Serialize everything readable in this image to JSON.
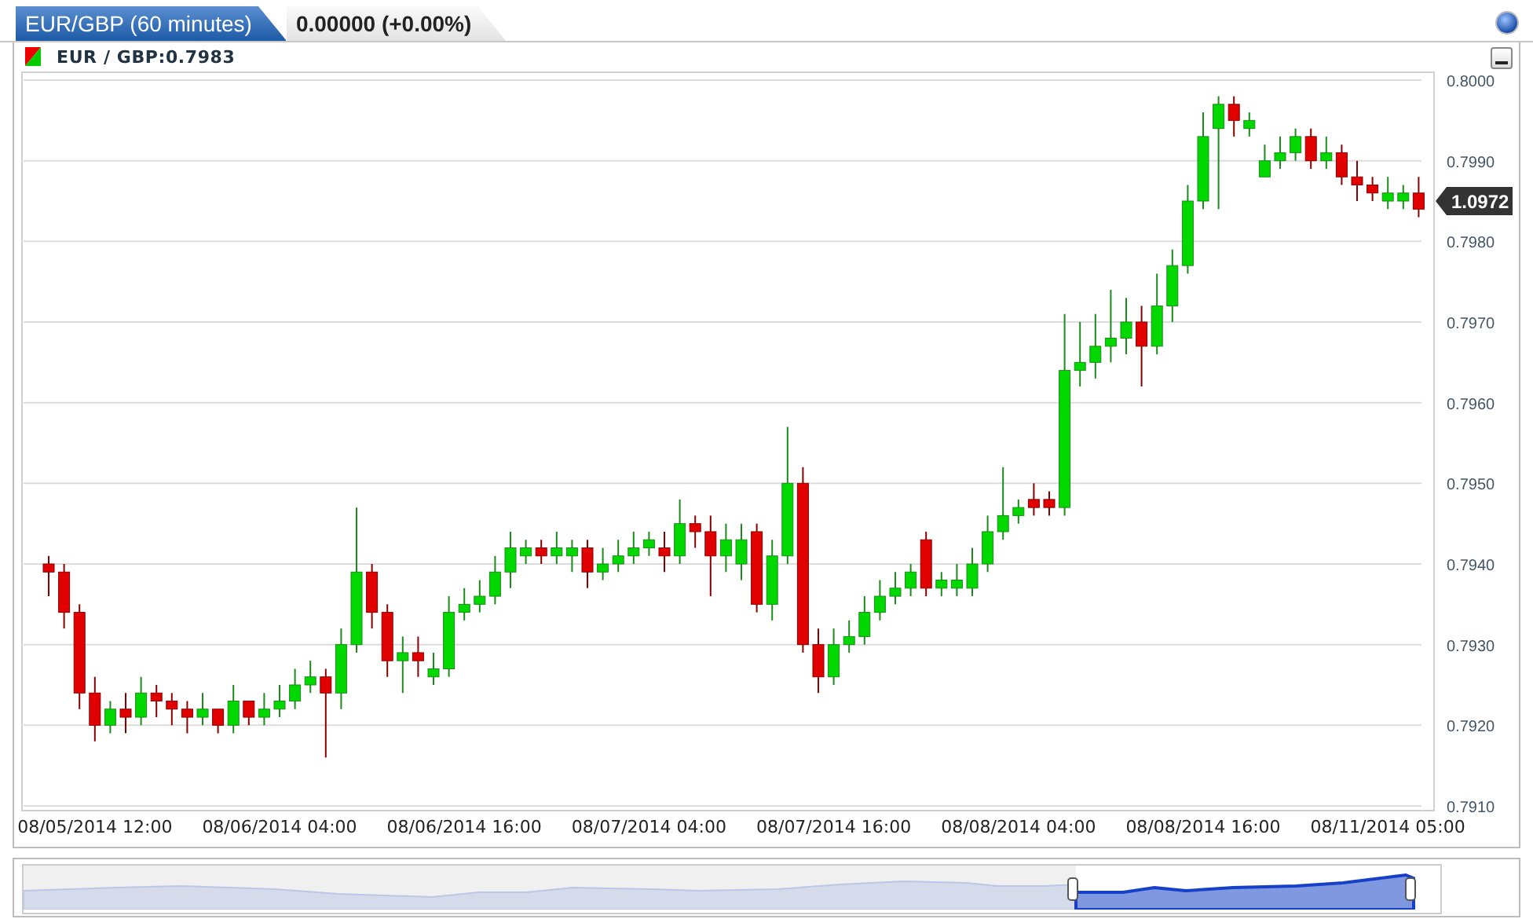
{
  "tabs": [
    {
      "label": "EUR/GBP (60 minutes)",
      "selected": true
    },
    {
      "label": "0.00000 (+0.00%)",
      "selected": false
    }
  ],
  "legend": {
    "label": "EUR / GBP:0.7983"
  },
  "price_marker": "1.0972",
  "chart_data": {
    "type": "candlestick",
    "grid": true,
    "ylim": [
      0.791,
      0.8
    ],
    "yticks": [
      {
        "value": 0.8,
        "label": "0.8000"
      },
      {
        "value": 0.799,
        "label": "0.7990"
      },
      {
        "value": 0.798,
        "label": "0.7980"
      },
      {
        "value": 0.797,
        "label": "0.7970"
      },
      {
        "value": 0.796,
        "label": "0.7960"
      },
      {
        "value": 0.795,
        "label": "0.7950"
      },
      {
        "value": 0.794,
        "label": "0.7940"
      },
      {
        "value": 0.793,
        "label": "0.7930"
      },
      {
        "value": 0.792,
        "label": "0.7920"
      },
      {
        "value": 0.791,
        "label": "0.7910"
      }
    ],
    "categories": [
      null,
      null,
      null,
      "08/05/2014 12:00",
      null,
      null,
      null,
      null,
      null,
      null,
      null,
      null,
      null,
      null,
      null,
      "08/06/2014 04:00",
      null,
      null,
      null,
      null,
      null,
      null,
      null,
      null,
      null,
      null,
      null,
      "08/06/2014 16:00",
      null,
      null,
      null,
      null,
      null,
      null,
      null,
      null,
      null,
      null,
      null,
      "08/07/2014 04:00",
      null,
      null,
      null,
      null,
      null,
      null,
      null,
      null,
      null,
      null,
      null,
      "08/07/2014 16:00",
      null,
      null,
      null,
      null,
      null,
      null,
      null,
      null,
      null,
      null,
      null,
      "08/08/2014 04:00",
      null,
      null,
      null,
      null,
      null,
      null,
      null,
      null,
      null,
      null,
      null,
      "08/08/2014 16:00",
      null,
      null,
      null,
      null,
      null,
      null,
      null,
      null,
      null,
      null,
      null,
      "08/11/2014 05:00",
      null,
      null
    ],
    "ohlc": [
      [
        0.794,
        0.7941,
        0.7936,
        0.7939
      ],
      [
        0.7939,
        0.794,
        0.7932,
        0.7934
      ],
      [
        0.7934,
        0.7935,
        0.7922,
        0.7924
      ],
      [
        0.7924,
        0.7926,
        0.7918,
        0.792
      ],
      [
        0.792,
        0.7923,
        0.7919,
        0.7922
      ],
      [
        0.7922,
        0.7924,
        0.7919,
        0.7921
      ],
      [
        0.7921,
        0.7926,
        0.792,
        0.7924
      ],
      [
        0.7924,
        0.7925,
        0.7921,
        0.7923
      ],
      [
        0.7923,
        0.7924,
        0.792,
        0.7922
      ],
      [
        0.7922,
        0.7923,
        0.7919,
        0.7921
      ],
      [
        0.7921,
        0.7924,
        0.792,
        0.7922
      ],
      [
        0.7922,
        0.7922,
        0.7919,
        0.792
      ],
      [
        0.792,
        0.7925,
        0.7919,
        0.7923
      ],
      [
        0.7923,
        0.7923,
        0.792,
        0.7921
      ],
      [
        0.7921,
        0.7924,
        0.792,
        0.7922
      ],
      [
        0.7922,
        0.7925,
        0.7921,
        0.7923
      ],
      [
        0.7923,
        0.7927,
        0.7922,
        0.7925
      ],
      [
        0.7925,
        0.7928,
        0.7924,
        0.7926
      ],
      [
        0.7926,
        0.7927,
        0.7916,
        0.7924
      ],
      [
        0.7924,
        0.7932,
        0.7922,
        0.793
      ],
      [
        0.793,
        0.7947,
        0.7929,
        0.7939
      ],
      [
        0.7939,
        0.794,
        0.7932,
        0.7934
      ],
      [
        0.7934,
        0.7935,
        0.7926,
        0.7928
      ],
      [
        0.7928,
        0.7931,
        0.7924,
        0.7929
      ],
      [
        0.7929,
        0.7931,
        0.7926,
        0.7928
      ],
      [
        0.7926,
        0.7929,
        0.7925,
        0.7927
      ],
      [
        0.7927,
        0.7936,
        0.7926,
        0.7934
      ],
      [
        0.7934,
        0.7937,
        0.7933,
        0.7935
      ],
      [
        0.7935,
        0.7938,
        0.7934,
        0.7936
      ],
      [
        0.7936,
        0.7941,
        0.7935,
        0.7939
      ],
      [
        0.7939,
        0.7944,
        0.7937,
        0.7942
      ],
      [
        0.7941,
        0.7943,
        0.794,
        0.7942
      ],
      [
        0.7942,
        0.7943,
        0.794,
        0.7941
      ],
      [
        0.7941,
        0.7944,
        0.794,
        0.7942
      ],
      [
        0.7941,
        0.7943,
        0.7939,
        0.7942
      ],
      [
        0.7942,
        0.7943,
        0.7937,
        0.7939
      ],
      [
        0.7939,
        0.7942,
        0.7938,
        0.794
      ],
      [
        0.794,
        0.7943,
        0.7939,
        0.7941
      ],
      [
        0.7941,
        0.7944,
        0.794,
        0.7942
      ],
      [
        0.7942,
        0.7944,
        0.7941,
        0.7943
      ],
      [
        0.7942,
        0.7944,
        0.7939,
        0.7941
      ],
      [
        0.7941,
        0.7948,
        0.794,
        0.7945
      ],
      [
        0.7945,
        0.7946,
        0.7942,
        0.7944
      ],
      [
        0.7944,
        0.7946,
        0.7936,
        0.7941
      ],
      [
        0.7941,
        0.7945,
        0.7939,
        0.7943
      ],
      [
        0.794,
        0.7945,
        0.7938,
        0.7943
      ],
      [
        0.7944,
        0.7945,
        0.7934,
        0.7935
      ],
      [
        0.7935,
        0.7943,
        0.7933,
        0.7941
      ],
      [
        0.7941,
        0.7957,
        0.794,
        0.795
      ],
      [
        0.795,
        0.7952,
        0.7929,
        0.793
      ],
      [
        0.793,
        0.7932,
        0.7924,
        0.7926
      ],
      [
        0.7926,
        0.7932,
        0.7925,
        0.793
      ],
      [
        0.793,
        0.7933,
        0.7929,
        0.7931
      ],
      [
        0.7931,
        0.7936,
        0.793,
        0.7934
      ],
      [
        0.7934,
        0.7938,
        0.7933,
        0.7936
      ],
      [
        0.7936,
        0.7939,
        0.7935,
        0.7937
      ],
      [
        0.7937,
        0.794,
        0.7936,
        0.7939
      ],
      [
        0.7943,
        0.7944,
        0.7936,
        0.7937
      ],
      [
        0.7937,
        0.7939,
        0.7936,
        0.7938
      ],
      [
        0.7937,
        0.794,
        0.7936,
        0.7938
      ],
      [
        0.7937,
        0.7942,
        0.7936,
        0.794
      ],
      [
        0.794,
        0.7946,
        0.7939,
        0.7944
      ],
      [
        0.7944,
        0.7952,
        0.7943,
        0.7946
      ],
      [
        0.7946,
        0.7948,
        0.7945,
        0.7947
      ],
      [
        0.7948,
        0.795,
        0.7946,
        0.7947
      ],
      [
        0.7948,
        0.7949,
        0.7946,
        0.7947
      ],
      [
        0.7947,
        0.7971,
        0.7946,
        0.7964
      ],
      [
        0.7964,
        0.797,
        0.7962,
        0.7965
      ],
      [
        0.7965,
        0.7971,
        0.7963,
        0.7967
      ],
      [
        0.7967,
        0.7974,
        0.7965,
        0.7968
      ],
      [
        0.7968,
        0.7973,
        0.7966,
        0.797
      ],
      [
        0.797,
        0.7972,
        0.7962,
        0.7967
      ],
      [
        0.7967,
        0.7976,
        0.7966,
        0.7972
      ],
      [
        0.7972,
        0.7979,
        0.797,
        0.7977
      ],
      [
        0.7977,
        0.7987,
        0.7976,
        0.7985
      ],
      [
        0.7985,
        0.7996,
        0.7984,
        0.7993
      ],
      [
        0.7994,
        0.7998,
        0.7984,
        0.7997
      ],
      [
        0.7997,
        0.7998,
        0.7993,
        0.7995
      ],
      [
        0.7994,
        0.7996,
        0.7993,
        0.7995
      ],
      [
        0.7988,
        0.7992,
        0.7988,
        0.799
      ],
      [
        0.799,
        0.7993,
        0.7989,
        0.7991
      ],
      [
        0.7991,
        0.7994,
        0.799,
        0.7993
      ],
      [
        0.7993,
        0.7994,
        0.7989,
        0.799
      ],
      [
        0.799,
        0.7993,
        0.7989,
        0.7991
      ],
      [
        0.7991,
        0.7992,
        0.7987,
        0.7988
      ],
      [
        0.7988,
        0.799,
        0.7985,
        0.7987
      ],
      [
        0.7987,
        0.7988,
        0.7985,
        0.7986
      ],
      [
        0.7985,
        0.7988,
        0.7984,
        0.7986
      ],
      [
        0.7985,
        0.7987,
        0.7984,
        0.7986
      ],
      [
        0.7986,
        0.7988,
        0.7983,
        0.7984
      ]
    ]
  }
}
